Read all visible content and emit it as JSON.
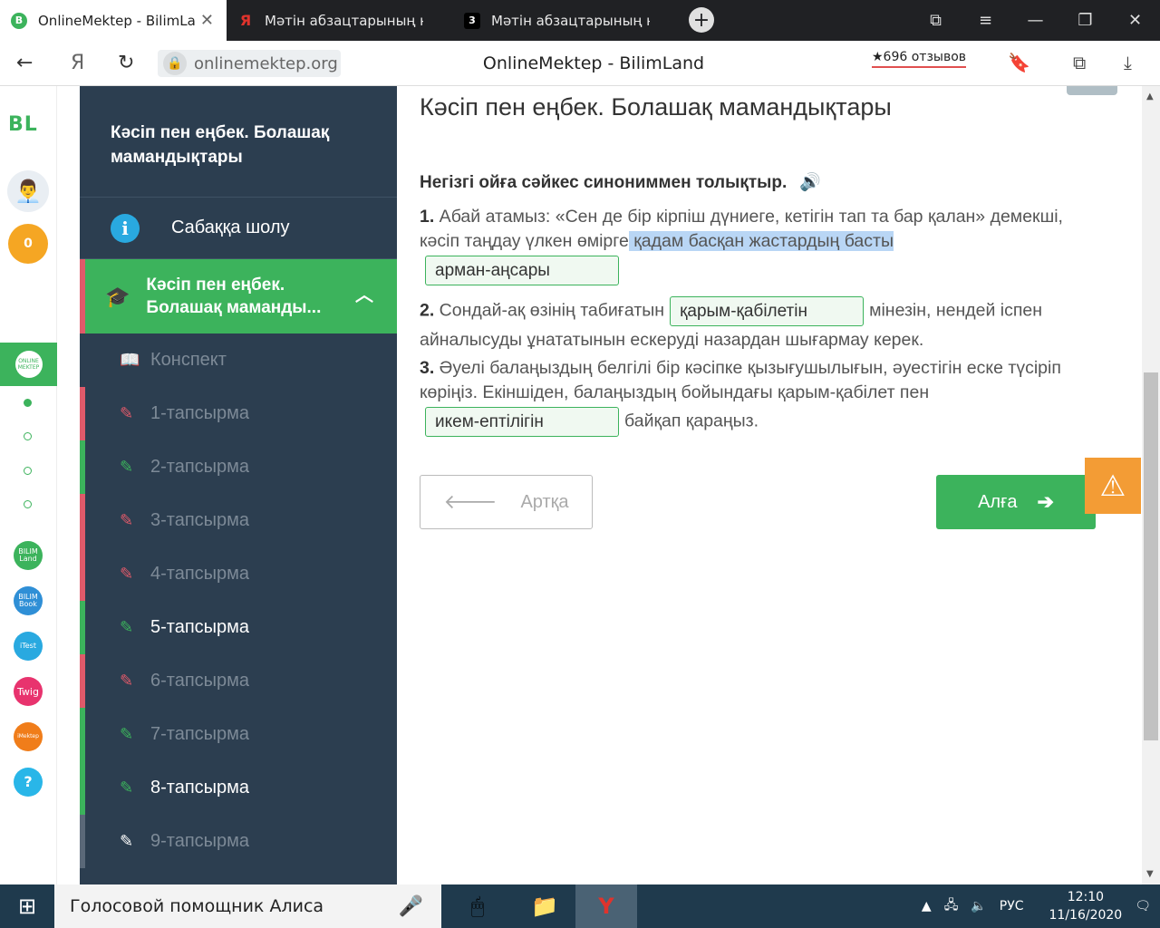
{
  "browser": {
    "tabs": [
      {
        "title": "OnlineMektep - BilimLand",
        "favicon": "B",
        "active": true
      },
      {
        "title": "Мәтін абзацтарының негі",
        "favicon": "Я",
        "active": false
      },
      {
        "title": "Мәтін абзацтарының негі",
        "favicon": "3",
        "active": false
      }
    ],
    "url": "onlinemektep.org",
    "page_title": "OnlineMektep - BilimLand",
    "reviews": "★696 отзывов"
  },
  "rail": {
    "logo": "BL",
    "score": "0",
    "apps": [
      "BILIM Land",
      "BILIM Book",
      "iTest",
      "Twig",
      "iMektep",
      "?"
    ]
  },
  "sidebar": {
    "title": "Кәсіп пен еңбек. Болашақ мамандықтары",
    "overview": "Сабаққа шолу",
    "active_section": "Кәсіп пен еңбек. Болашақ маманды...",
    "items": [
      {
        "label": "Конспект",
        "status": "green",
        "icon": "book-icon"
      },
      {
        "label": "1-тапсырма",
        "status": "red",
        "icon": "edit-icon"
      },
      {
        "label": "2-тапсырма",
        "status": "green",
        "icon": "edit-icon"
      },
      {
        "label": "3-тапсырма",
        "status": "red",
        "icon": "edit-icon"
      },
      {
        "label": "4-тапсырма",
        "status": "red",
        "icon": "edit-icon"
      },
      {
        "label": "5-тапсырма",
        "status": "green",
        "icon": "edit-icon"
      },
      {
        "label": "6-тапсырма",
        "status": "red",
        "icon": "edit-icon"
      },
      {
        "label": "7-тапсырма",
        "status": "green",
        "icon": "edit-icon"
      },
      {
        "label": "8-тапсырма",
        "status": "green",
        "icon": "edit-icon"
      },
      {
        "label": "9-тапсырма",
        "status": "gray",
        "icon": "edit-icon"
      }
    ]
  },
  "main": {
    "lesson_title": "Кәсіп пен еңбек. Болашақ мамандықтары",
    "task_heading": "Негізгі ойға сәйкес синониммен толықтыр.",
    "p1": {
      "num": "1.",
      "text_a": " Абай атамыз: «Сен де бір кірпіш дүниеге, кетігін тап та бар қалан» демекші, кәсіп таңдау үлкен өмірге",
      "text_hl": " қадам басқан жастардың басты",
      "answer": "арман-аңсары"
    },
    "p2": {
      "num": "2.",
      "text_a": " Сондай-ақ өзінің табиғатын",
      "answer": "қарым-қабілетін",
      "text_b": "мінезін, нендей іспен айналысуды ұнататынын ескеруді назардан шығармау керек."
    },
    "p3": {
      "num": "3.",
      "text_a": " Әуелі балаңыздың белгілі бір кәсіпке қызығушылығын, әуестігін еске түсіріп көріңіз. Екіншіден, балаңыздың бойындағы қарым-қабілет пен",
      "answer": "икем-ептілігін",
      "text_b": "байқап қараңыз."
    },
    "back_label": "Артқа",
    "next_label": "Алға"
  },
  "taskbar": {
    "search": "Голосовой помощник Алиса",
    "lang": "РУС",
    "time": "12:10",
    "date": "11/16/2020"
  }
}
